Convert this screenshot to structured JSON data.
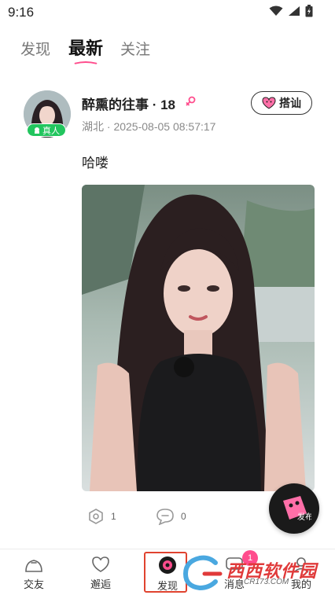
{
  "status_bar": {
    "time": "9:16",
    "icons": [
      "wifi-icon",
      "signal-icon",
      "battery-icon"
    ]
  },
  "top_tabs": [
    {
      "label": "发现",
      "active": false
    },
    {
      "label": "最新",
      "active": true
    },
    {
      "label": "关注",
      "active": false
    }
  ],
  "post": {
    "username": "醉熏的往事 · 18",
    "gender": "female",
    "meta": "湖北 · 2025-08-05 08:57:17",
    "real_badge": "真人",
    "greet_label": "搭讪",
    "text": "哈喽",
    "like_count": "1",
    "comment_count": "0"
  },
  "fab": {
    "label": "发布"
  },
  "bottom_nav": [
    {
      "label": "交友",
      "icon": "make-friends-icon"
    },
    {
      "label": "邂逅",
      "icon": "encounter-icon"
    },
    {
      "label": "发现",
      "icon": "discover-icon",
      "active": true
    },
    {
      "label": "消息",
      "icon": "message-icon",
      "badge": "1"
    },
    {
      "label": "我的",
      "icon": "profile-icon"
    }
  ],
  "watermark": {
    "text": "西西软件园",
    "sub": "CR173.COM"
  },
  "colors": {
    "accent": "#ff4d8d",
    "highlight": "#e0432f",
    "verified": "#22c55e"
  }
}
